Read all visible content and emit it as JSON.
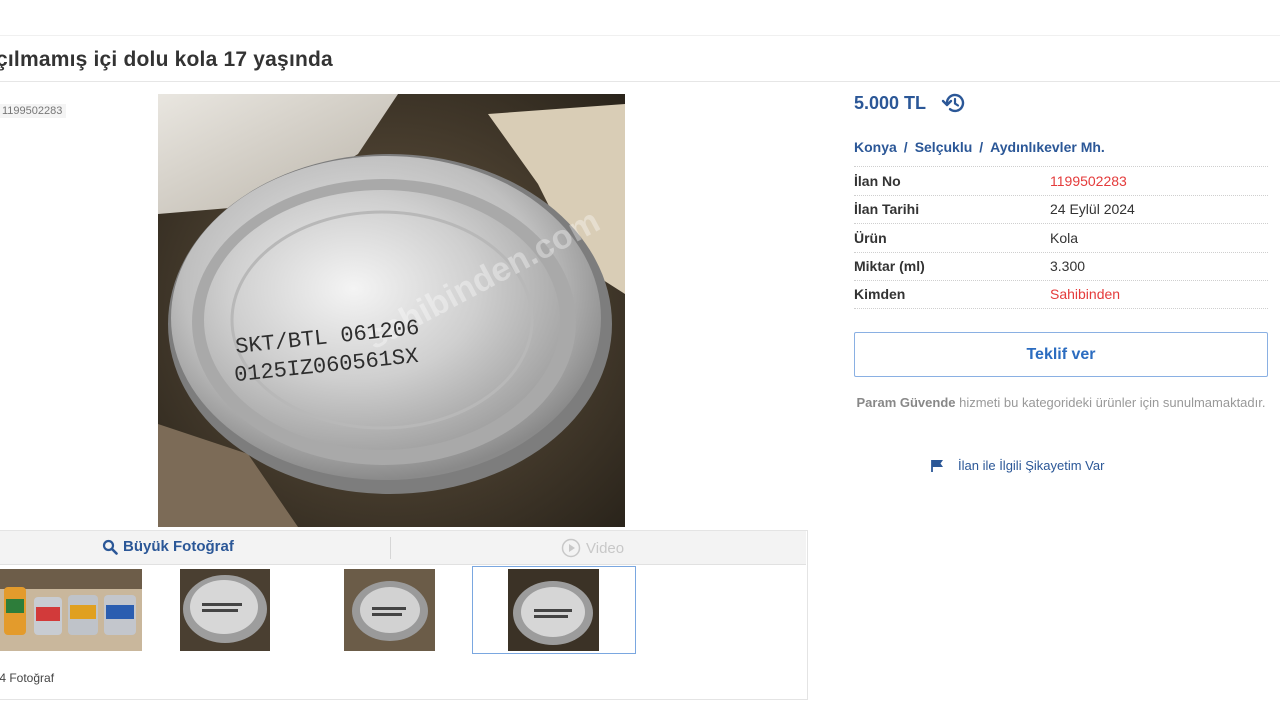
{
  "header": {
    "title": "çılmamış içi dolu kola 17 yaşında"
  },
  "gallery": {
    "listing_no_small": "1199502283",
    "tab_big_photo": "Büyük Fotoğraf",
    "tab_video": "Video",
    "photo_count": "/4 Fotoğraf",
    "main_photo_text_line1": "SKT/BTL 061206",
    "main_photo_text_line2": "0125IZ060561SX",
    "watermark": "sahibinden.com"
  },
  "listing": {
    "price": "5.000 TL",
    "location": {
      "city": "Konya",
      "district": "Selçuklu",
      "neighborhood": "Aydınlıkevler Mh.",
      "separator": "/"
    },
    "details": [
      {
        "label": "İlan No",
        "value": "1199502283",
        "highlight": true
      },
      {
        "label": "İlan Tarihi",
        "value": "24 Eylül 2024",
        "highlight": false
      },
      {
        "label": "Ürün",
        "value": "Kola",
        "highlight": false
      },
      {
        "label": "Miktar (ml)",
        "value": "3.300",
        "highlight": false
      },
      {
        "label": "Kimden",
        "value": "Sahibinden",
        "highlight": true
      }
    ],
    "offer_button": "Teklif ver",
    "secure_note_bold": "Param Güvende",
    "secure_note_rest": " hizmeti bu kategorideki ürünler için sunulmamaktadır.",
    "complaint_link": "İlan ile İlgili Şikayetim Var"
  },
  "colors": {
    "accent": "#2b5797",
    "link": "#2b6cc0",
    "highlight_red": "#e43b3b"
  }
}
